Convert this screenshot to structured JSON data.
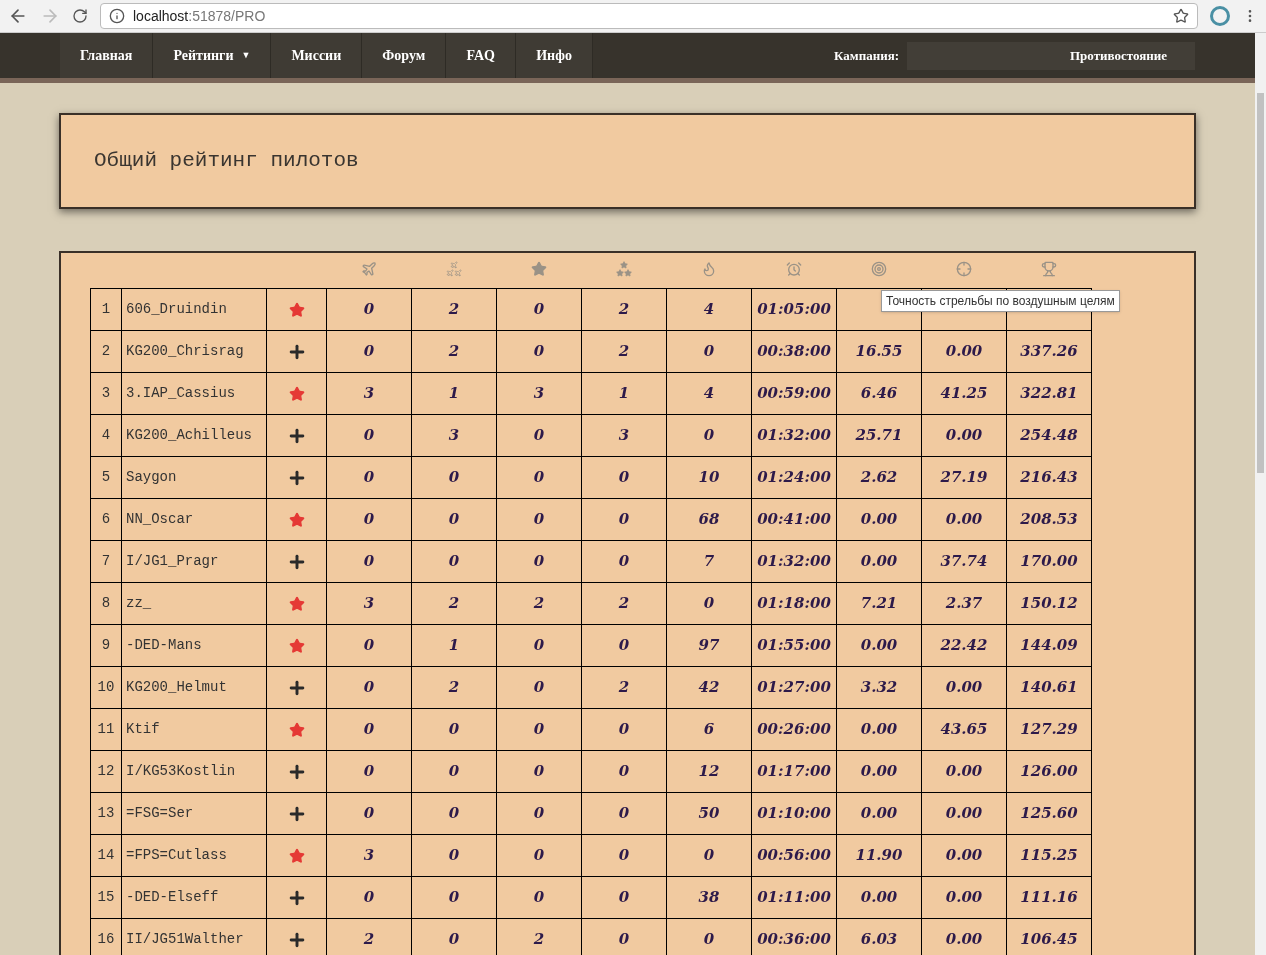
{
  "browser": {
    "url_host": "localhost",
    "url_path": ":51878/PRO"
  },
  "nav": {
    "items": [
      {
        "label": "Главная"
      },
      {
        "label": "Рейтинги",
        "caret": "▼"
      },
      {
        "label": "Миссии"
      },
      {
        "label": "Форум"
      },
      {
        "label": "FAQ"
      },
      {
        "label": "Инфо"
      }
    ],
    "campaign_label": "Кампания:",
    "campaign_value": "Противостояние"
  },
  "title": "Общий рейтинг пилотов",
  "tooltip": "Точность стрельбы по воздушным целям",
  "table": {
    "columns": [
      {
        "kind": "plane"
      },
      {
        "kind": "planes"
      },
      {
        "kind": "star"
      },
      {
        "kind": "stars"
      },
      {
        "kind": "fire"
      },
      {
        "kind": "clock"
      },
      {
        "kind": "target"
      },
      {
        "kind": "target-arrow"
      },
      {
        "kind": "trophy"
      }
    ],
    "rows": [
      {
        "rank": "1",
        "name": "606_Druindin",
        "kind": "soviet",
        "values": [
          "0",
          "2",
          "0",
          "2",
          "4",
          "01:05:00"
        ]
      },
      {
        "rank": "2",
        "name": "KG200_Chrisrag",
        "kind": "german",
        "values": [
          "0",
          "2",
          "0",
          "2",
          "0",
          "00:38:00",
          "16.55",
          "0.00",
          "337.26"
        ]
      },
      {
        "rank": "3",
        "name": "3.IAP_Cassius",
        "kind": "soviet",
        "values": [
          "3",
          "1",
          "3",
          "1",
          "4",
          "00:59:00",
          "6.46",
          "41.25",
          "322.81"
        ]
      },
      {
        "rank": "4",
        "name": "KG200_Achilleus",
        "kind": "german",
        "values": [
          "0",
          "3",
          "0",
          "3",
          "0",
          "01:32:00",
          "25.71",
          "0.00",
          "254.48"
        ]
      },
      {
        "rank": "5",
        "name": "Saygon",
        "kind": "german",
        "values": [
          "0",
          "0",
          "0",
          "0",
          "10",
          "01:24:00",
          "2.62",
          "27.19",
          "216.43"
        ]
      },
      {
        "rank": "6",
        "name": "NN_Oscar",
        "kind": "soviet",
        "values": [
          "0",
          "0",
          "0",
          "0",
          "68",
          "00:41:00",
          "0.00",
          "0.00",
          "208.53"
        ]
      },
      {
        "rank": "7",
        "name": "I/JG1_Pragr",
        "kind": "german",
        "values": [
          "0",
          "0",
          "0",
          "0",
          "7",
          "01:32:00",
          "0.00",
          "37.74",
          "170.00"
        ]
      },
      {
        "rank": "8",
        "name": "zz_",
        "kind": "soviet",
        "values": [
          "3",
          "2",
          "2",
          "2",
          "0",
          "01:18:00",
          "7.21",
          "2.37",
          "150.12"
        ]
      },
      {
        "rank": "9",
        "name": "-DED-Mans",
        "kind": "soviet",
        "values": [
          "0",
          "1",
          "0",
          "0",
          "97",
          "01:55:00",
          "0.00",
          "22.42",
          "144.09"
        ]
      },
      {
        "rank": "10",
        "name": "KG200_Helmut",
        "kind": "german",
        "values": [
          "0",
          "2",
          "0",
          "2",
          "42",
          "01:27:00",
          "3.32",
          "0.00",
          "140.61"
        ]
      },
      {
        "rank": "11",
        "name": "Ktif",
        "kind": "soviet",
        "values": [
          "0",
          "0",
          "0",
          "0",
          "6",
          "00:26:00",
          "0.00",
          "43.65",
          "127.29"
        ]
      },
      {
        "rank": "12",
        "name": "I/KG53Kostlin",
        "kind": "german",
        "values": [
          "0",
          "0",
          "0",
          "0",
          "12",
          "01:17:00",
          "0.00",
          "0.00",
          "126.00"
        ]
      },
      {
        "rank": "13",
        "name": "=FSG=Ser",
        "kind": "german",
        "values": [
          "0",
          "0",
          "0",
          "0",
          "50",
          "01:10:00",
          "0.00",
          "0.00",
          "125.60"
        ]
      },
      {
        "rank": "14",
        "name": "=FPS=Cutlass",
        "kind": "soviet",
        "values": [
          "3",
          "0",
          "0",
          "0",
          "0",
          "00:56:00",
          "11.90",
          "0.00",
          "115.25"
        ]
      },
      {
        "rank": "15",
        "name": "-DED-Elseff",
        "kind": "german",
        "values": [
          "0",
          "0",
          "0",
          "0",
          "38",
          "01:11:00",
          "0.00",
          "0.00",
          "111.16"
        ]
      },
      {
        "rank": "16",
        "name": "II/JG51Walther",
        "kind": "german",
        "values": [
          "2",
          "0",
          "2",
          "0",
          "0",
          "00:36:00",
          "6.03",
          "0.00",
          "106.45"
        ]
      }
    ]
  }
}
